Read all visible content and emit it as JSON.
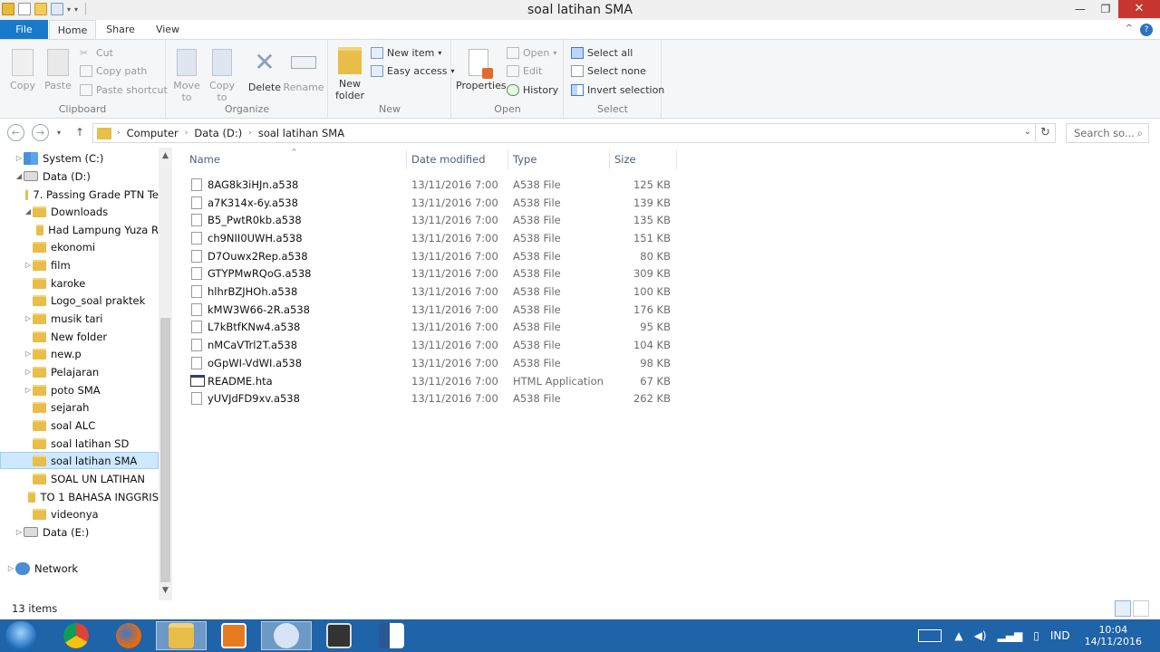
{
  "window": {
    "title": "soal latihan SMA"
  },
  "tabs": [
    "File",
    "Home",
    "Share",
    "View"
  ],
  "ribbon": {
    "clipboard": {
      "label": "Clipboard",
      "copy": "Copy",
      "paste": "Paste",
      "cut": "Cut",
      "copy_path": "Copy path",
      "paste_shortcut": "Paste shortcut"
    },
    "organize": {
      "label": "Organize",
      "move_to": "Move to",
      "copy_to": "Copy to",
      "delete": "Delete",
      "rename": "Rename"
    },
    "new": {
      "label": "New",
      "new_folder": "New folder",
      "new_item": "New item",
      "easy_access": "Easy access"
    },
    "open": {
      "label": "Open",
      "properties": "Properties",
      "open": "Open",
      "edit": "Edit",
      "history": "History"
    },
    "select": {
      "label": "Select",
      "select_all": "Select all",
      "select_none": "Select none",
      "invert_selection": "Invert selection"
    }
  },
  "address": {
    "crumbs": [
      "Computer",
      "Data (D:)",
      "soal latihan SMA"
    ]
  },
  "search": {
    "placeholder": "Search so..."
  },
  "tree": [
    {
      "label": "System (C:)",
      "icon": "system-drive"
    },
    {
      "label": "Data (D:)",
      "icon": "drive"
    },
    {
      "label": "7. Passing Grade PTN Te",
      "icon": "folder"
    },
    {
      "label": "Downloads",
      "icon": "folder"
    },
    {
      "label": "Had Lampung Yuza R",
      "icon": "folder"
    },
    {
      "label": "ekonomi",
      "icon": "folder"
    },
    {
      "label": "film",
      "icon": "folder"
    },
    {
      "label": "karoke",
      "icon": "folder"
    },
    {
      "label": "Logo_soal praktek",
      "icon": "folder"
    },
    {
      "label": "musik tari",
      "icon": "folder"
    },
    {
      "label": "New folder",
      "icon": "folder"
    },
    {
      "label": "new.p",
      "icon": "folder"
    },
    {
      "label": "Pelajaran",
      "icon": "folder"
    },
    {
      "label": "poto SMA",
      "icon": "folder"
    },
    {
      "label": "sejarah",
      "icon": "folder"
    },
    {
      "label": "soal ALC",
      "icon": "folder"
    },
    {
      "label": "soal latihan SD",
      "icon": "folder"
    },
    {
      "label": "soal latihan SMA",
      "icon": "folder"
    },
    {
      "label": "SOAL UN LATIHAN",
      "icon": "folder"
    },
    {
      "label": "TO   1 BAHASA INGGRIS",
      "icon": "folder"
    },
    {
      "label": "videonya",
      "icon": "folder"
    },
    {
      "label": "Data (E:)",
      "icon": "drive"
    },
    {
      "label": "Network",
      "icon": "network"
    }
  ],
  "columns": {
    "name": "Name",
    "date": "Date modified",
    "type": "Type",
    "size": "Size"
  },
  "files": [
    {
      "name": "8AG8k3iHJn.a538",
      "date": "13/11/2016 7:00",
      "type": "A538 File",
      "size": "125 KB"
    },
    {
      "name": "a7K314x-6y.a538",
      "date": "13/11/2016 7:00",
      "type": "A538 File",
      "size": "139 KB"
    },
    {
      "name": "B5_PwtR0kb.a538",
      "date": "13/11/2016 7:00",
      "type": "A538 File",
      "size": "135 KB"
    },
    {
      "name": "ch9NII0UWH.a538",
      "date": "13/11/2016 7:00",
      "type": "A538 File",
      "size": "151 KB"
    },
    {
      "name": "D7Ouwx2Rep.a538",
      "date": "13/11/2016 7:00",
      "type": "A538 File",
      "size": "80 KB"
    },
    {
      "name": "GTYPMwRQoG.a538",
      "date": "13/11/2016 7:00",
      "type": "A538 File",
      "size": "309 KB"
    },
    {
      "name": "hlhrBZJHOh.a538",
      "date": "13/11/2016 7:00",
      "type": "A538 File",
      "size": "100 KB"
    },
    {
      "name": "kMW3W66-2R.a538",
      "date": "13/11/2016 7:00",
      "type": "A538 File",
      "size": "176 KB"
    },
    {
      "name": "L7kBtfKNw4.a538",
      "date": "13/11/2016 7:00",
      "type": "A538 File",
      "size": "95 KB"
    },
    {
      "name": "nMCaVTrl2T.a538",
      "date": "13/11/2016 7:00",
      "type": "A538 File",
      "size": "104 KB"
    },
    {
      "name": "oGpWI-VdWI.a538",
      "date": "13/11/2016 7:00",
      "type": "A538 File",
      "size": "98 KB"
    },
    {
      "name": "README.hta",
      "date": "13/11/2016 7:00",
      "type": "HTML Application",
      "size": "67 KB"
    },
    {
      "name": "yUVJdFD9xv.a538",
      "date": "13/11/2016 7:00",
      "type": "A538 File",
      "size": "262 KB"
    }
  ],
  "status": {
    "count": "13 items"
  },
  "taskbar": {
    "lang": "IND",
    "time": "10:04",
    "date": "14/11/2016"
  },
  "colors": {
    "accent": "#1979ca",
    "selection": "#cde8ff",
    "taskbar": "#1f63a8",
    "close": "#c7372f"
  }
}
